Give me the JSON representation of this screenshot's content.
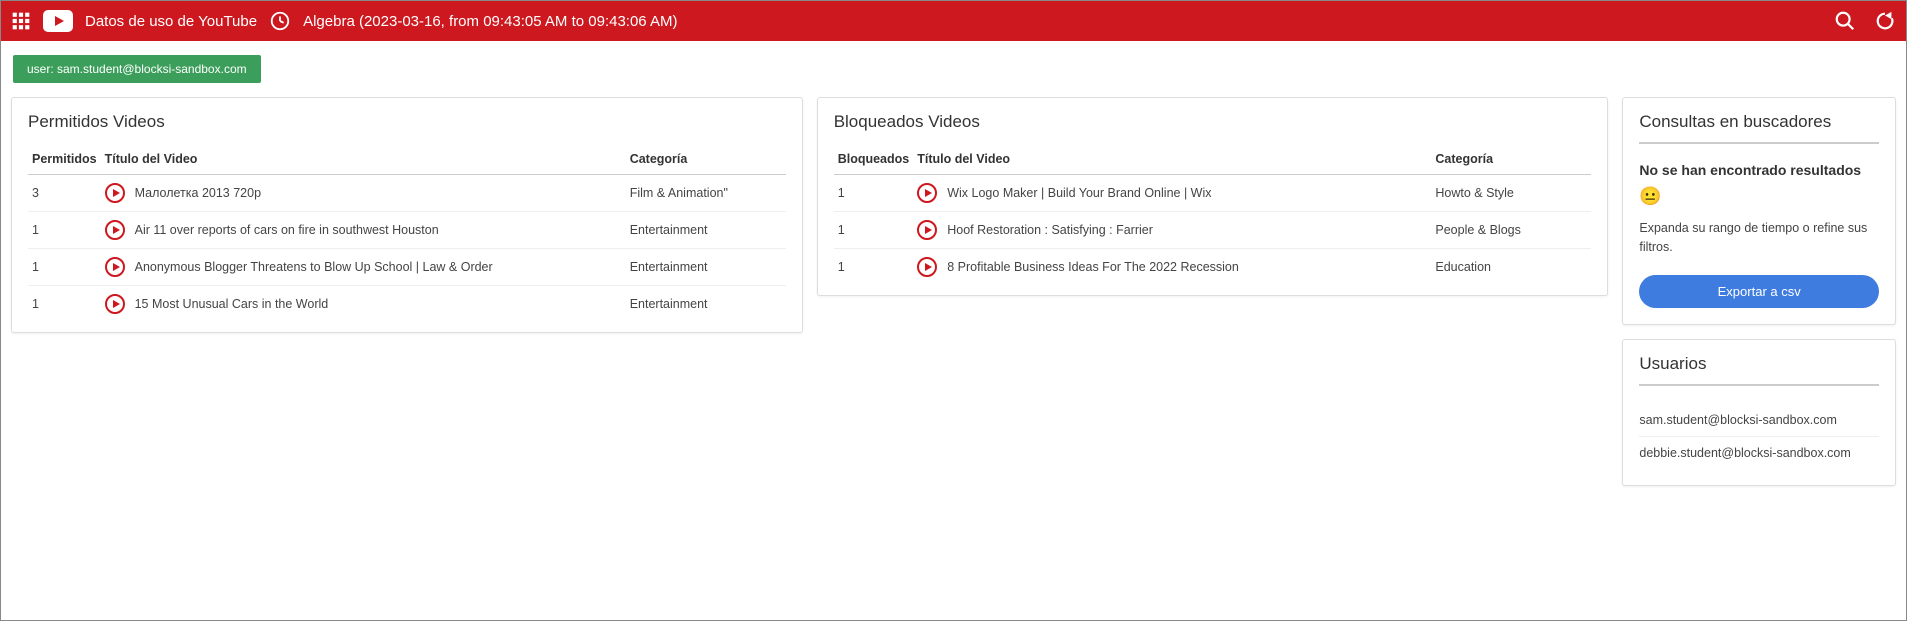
{
  "header": {
    "title": "Datos de uso de YouTube",
    "subtitle": "Algebra (2023-03-16, from 09:43:05 AM to 09:43:06 AM)"
  },
  "user_chip": "user: sam.student@blocksi-sandbox.com",
  "allowed": {
    "title": "Permitidos Videos",
    "cols": {
      "count": "Permitidos",
      "title": "Título del Video",
      "cat": "Categoría"
    },
    "rows": [
      {
        "count": "3",
        "title": "Малолетка 2013 720p",
        "cat": "Film & Animation\""
      },
      {
        "count": "1",
        "title": "Air 11 over reports of cars on fire in southwest Houston",
        "cat": "Entertainment"
      },
      {
        "count": "1",
        "title": "Anonymous Blogger Threatens to Blow Up School | Law & Order",
        "cat": "Entertainment"
      },
      {
        "count": "1",
        "title": "15 Most Unusual Cars in the World",
        "cat": "Entertainment"
      }
    ]
  },
  "blocked": {
    "title": "Bloqueados Videos",
    "cols": {
      "count": "Bloqueados",
      "title": "Título del Video",
      "cat": "Categoría"
    },
    "rows": [
      {
        "count": "1",
        "title": "Wix Logo Maker | Build Your Brand Online | Wix",
        "cat": "Howto & Style"
      },
      {
        "count": "1",
        "title": "Hoof Restoration : Satisfying : Farrier",
        "cat": "People & Blogs"
      },
      {
        "count": "1",
        "title": "8 Profitable Business Ideas For The 2022 Recession",
        "cat": "Education"
      }
    ]
  },
  "search_panel": {
    "title": "Consultas en buscadores",
    "no_results": "No se han encontrado resultados",
    "emoji": "😐",
    "hint": "Expanda su rango de tiempo o refine sus filtros.",
    "export_label": "Exportar a csv"
  },
  "users_panel": {
    "title": "Usuarios",
    "items": [
      "sam.student@blocksi-sandbox.com",
      "debbie.student@blocksi-sandbox.com"
    ]
  }
}
